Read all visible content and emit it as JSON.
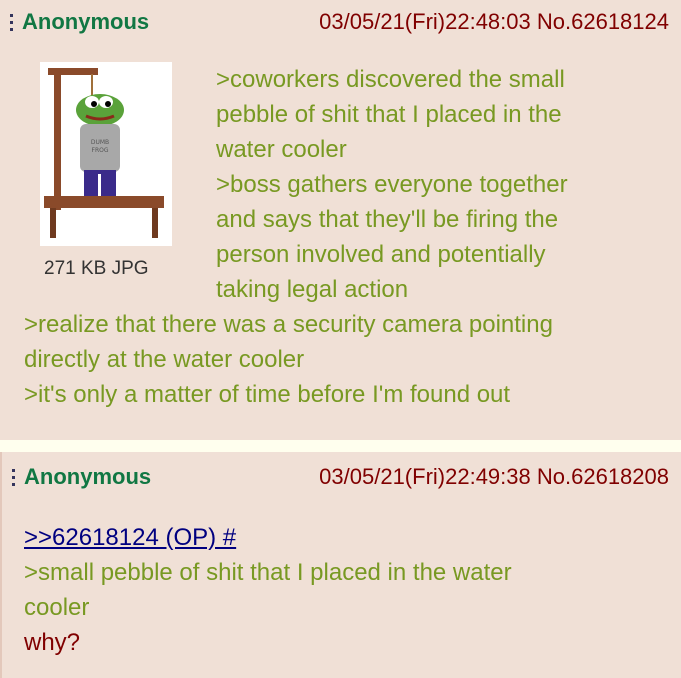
{
  "post1": {
    "name": "Anonymous",
    "datetime": "03/05/21(Fri)22:48:03",
    "number": "No.62618124",
    "file_size": "271 KB JPG",
    "lines": [
      ">coworkers discovered the small",
      "pebble of shit that I placed in the",
      "water cooler",
      ">boss gathers everyone together",
      "and says that they'll be firing the",
      "person involved and potentially",
      "taking legal action",
      ">realize that there was a security camera pointing",
      "directly at the water cooler",
      ">it's only a matter of time before I'm found out"
    ]
  },
  "post2": {
    "name": "Anonymous",
    "datetime": "03/05/21(Fri)22:49:38",
    "number": "No.62618208",
    "quote_link": ">>62618124 (OP) #",
    "lines": [
      ">small pebble of shit that I placed in the water",
      "cooler"
    ],
    "reply": "why?"
  },
  "colors": {
    "post_bg": "#f0e0d6",
    "greentext": "#789922",
    "name": "#117743",
    "link": "#000080"
  },
  "icons": [
    "post-menu-icon",
    "hanging-frog-image"
  ]
}
